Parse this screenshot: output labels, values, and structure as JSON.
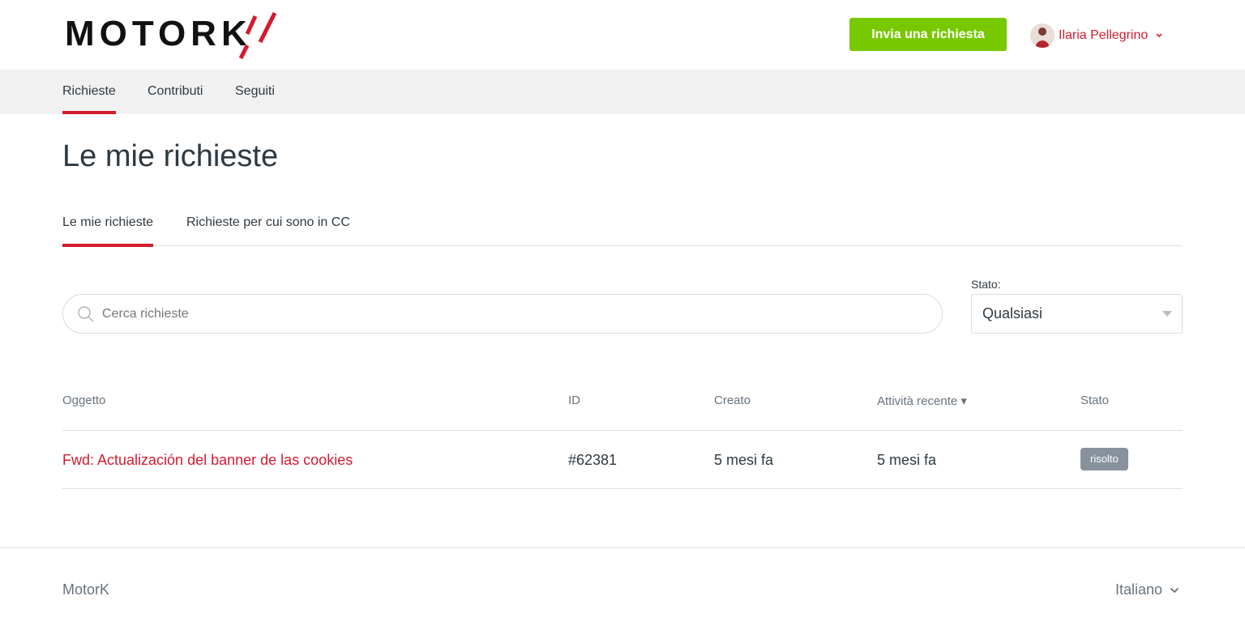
{
  "header": {
    "logo_text": "MOTORK",
    "cta_label": "Invia una richiesta",
    "user_name": "Ilaria Pellegrino"
  },
  "nav": {
    "items": [
      {
        "label": "Richieste",
        "active": true
      },
      {
        "label": "Contributi",
        "active": false
      },
      {
        "label": "Seguiti",
        "active": false
      }
    ]
  },
  "page": {
    "title": "Le mie richieste"
  },
  "tabs": [
    {
      "label": "Le mie richieste",
      "active": true
    },
    {
      "label": "Richieste per cui sono in CC",
      "active": false
    }
  ],
  "filters": {
    "search_placeholder": "Cerca richieste",
    "search_value": "",
    "status_label": "Stato:",
    "status_value": "Qualsiasi"
  },
  "table": {
    "columns": [
      "Oggetto",
      "ID",
      "Creato",
      "Attività recente ▾",
      "Stato"
    ],
    "rows": [
      {
        "subject": "Fwd: Actualización del banner de las cookies",
        "id": "#62381",
        "created": "5 mesi fa",
        "recent_activity": "5 mesi fa",
        "status": "risolto"
      }
    ]
  },
  "footer": {
    "brand": "MotorK",
    "language": "Italiano"
  },
  "colors": {
    "brand_red": "#d31b2f",
    "cta_green": "#78c800",
    "status_gray": "#87929d"
  }
}
